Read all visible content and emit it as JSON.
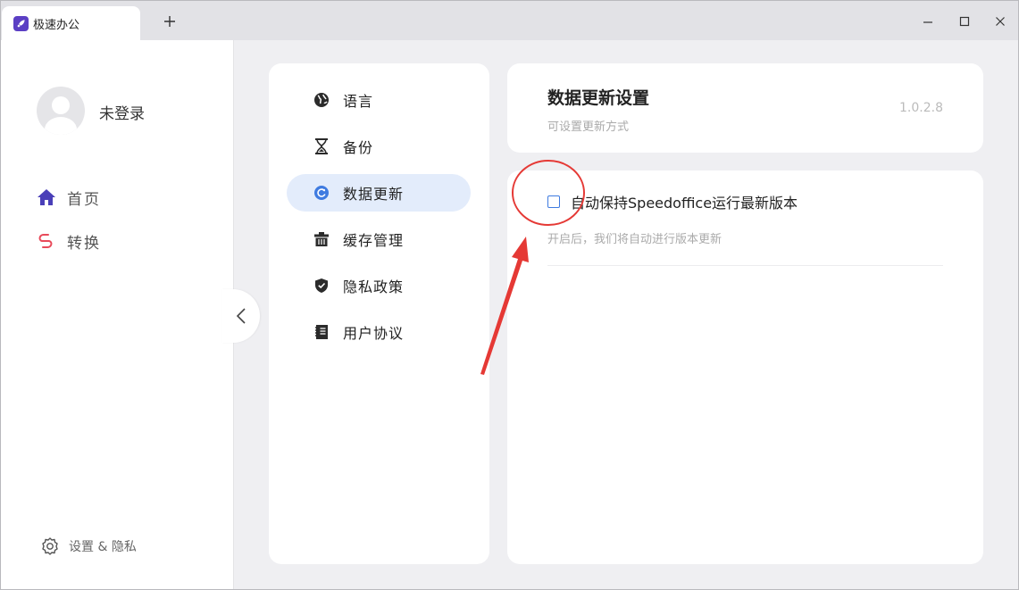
{
  "titlebar": {
    "tab_title": "极速办公",
    "new_tab_glyph": "+",
    "minimize_glyph": "—",
    "maximize_glyph": "☐",
    "close_glyph": "✕"
  },
  "sidebar": {
    "username": "未登录",
    "nav": [
      {
        "label": "首页",
        "icon": "home-icon",
        "color": "#4a3fb8"
      },
      {
        "label": "转换",
        "icon": "convert-icon",
        "color": "#e84a5a"
      }
    ],
    "settings_label": "设置 & 隐私"
  },
  "menu": {
    "items": [
      {
        "label": "语言",
        "icon": "globe-icon",
        "active": false
      },
      {
        "label": "备份",
        "icon": "hourglass-icon",
        "active": false
      },
      {
        "label": "数据更新",
        "icon": "refresh-icon",
        "active": true
      },
      {
        "label": "缓存管理",
        "icon": "trash-icon",
        "active": false
      },
      {
        "label": "隐私政策",
        "icon": "shield-icon",
        "active": false
      },
      {
        "label": "用户协议",
        "icon": "notebook-icon",
        "active": false
      }
    ]
  },
  "header": {
    "title": "数据更新设置",
    "subtitle": "可设置更新方式",
    "version": "1.0.2.8"
  },
  "settings": {
    "auto_update_label": "自动保持Speedoffice运行最新版本",
    "auto_update_checked": false,
    "hint": "开启后，我们将自动进行版本更新"
  },
  "colors": {
    "accent": "#3f7be0",
    "active_bg": "#e3ecfb",
    "annotation": "#e53935"
  }
}
